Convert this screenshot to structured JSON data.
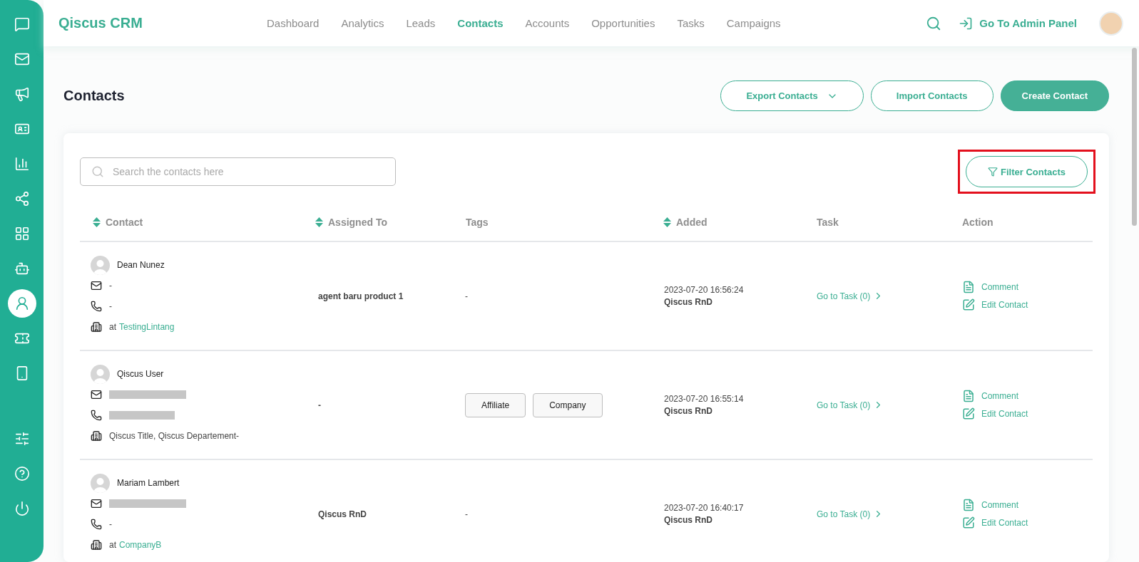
{
  "sidebar": {
    "items": [
      {
        "kind": "chat",
        "selected": false
      },
      {
        "kind": "mail",
        "selected": false
      },
      {
        "kind": "megaphone",
        "selected": false
      },
      {
        "kind": "card",
        "selected": false
      },
      {
        "kind": "chart",
        "selected": false
      },
      {
        "kind": "share",
        "selected": false
      },
      {
        "kind": "grid",
        "selected": false
      },
      {
        "kind": "bot",
        "selected": false
      },
      {
        "kind": "agent",
        "selected": true
      },
      {
        "kind": "ticket",
        "selected": false
      },
      {
        "kind": "phone",
        "selected": false
      }
    ],
    "bottom_items": [
      {
        "kind": "sliders"
      },
      {
        "kind": "help"
      },
      {
        "kind": "power"
      }
    ]
  },
  "header": {
    "brand": "Qiscus CRM",
    "nav": [
      {
        "label": "Dashboard",
        "selected": false
      },
      {
        "label": "Analytics",
        "selected": false
      },
      {
        "label": "Leads",
        "selected": false
      },
      {
        "label": "Contacts",
        "selected": true
      },
      {
        "label": "Accounts",
        "selected": false
      },
      {
        "label": "Opportunities",
        "selected": false
      },
      {
        "label": "Tasks",
        "selected": false
      },
      {
        "label": "Campaigns",
        "selected": false
      }
    ],
    "admin_link": "Go To Admin Panel"
  },
  "page": {
    "title": "Contacts",
    "buttons": [
      {
        "label": "Export Contacts",
        "kind": "dropdown"
      },
      {
        "label": "Import Contacts",
        "kind": "outline"
      },
      {
        "label": "Create Contact",
        "kind": "primary"
      }
    ]
  },
  "search": {
    "placeholder": "Search the contacts here"
  },
  "filter_button": {
    "label": "Filter Contacts",
    "highlighted": true
  },
  "table": {
    "columns": [
      {
        "label": "Contact",
        "sortable": true
      },
      {
        "label": "Assigned To",
        "sortable": true
      },
      {
        "label": "Tags",
        "sortable": false
      },
      {
        "label": "Added",
        "sortable": true
      },
      {
        "label": "Task",
        "sortable": false
      },
      {
        "label": "Action",
        "sortable": false
      }
    ],
    "rows": [
      {
        "name": "Dean Nunez",
        "email": {
          "kind": "text",
          "value": "-"
        },
        "phone": {
          "kind": "text",
          "value": "-"
        },
        "org": {
          "kind": "company",
          "prefix": "at",
          "value": "TestingLintang"
        },
        "assigned": "agent baru product 1",
        "tags": [],
        "tags_empty": "-",
        "added": "2023-07-20 16:56:24",
        "added_by": "Qiscus RnD",
        "task": "Go to Task (0)",
        "actions": [
          "Comment",
          "Edit Contact"
        ]
      },
      {
        "name": "Qiscus User",
        "email": {
          "kind": "redacted"
        },
        "phone": {
          "kind": "redacted"
        },
        "org": {
          "kind": "title",
          "value": "Qiscus Title, Qiscus Departement-"
        },
        "assigned": "-",
        "tags": [
          "Affiliate",
          "Company"
        ],
        "added": "2023-07-20 16:55:14",
        "added_by": "Qiscus RnD",
        "task": "Go to Task (0)",
        "actions": [
          "Comment",
          "Edit Contact"
        ]
      },
      {
        "name": "Mariam Lambert",
        "email": {
          "kind": "redacted"
        },
        "phone": {
          "kind": "text",
          "value": "-"
        },
        "org": {
          "kind": "company",
          "prefix": "at",
          "value": "CompanyB"
        },
        "assigned": "Qiscus RnD",
        "tags": [],
        "tags_empty": "-",
        "added": "2023-07-20 16:40:17",
        "added_by": "Qiscus RnD",
        "task": "Go to Task (0)",
        "actions": [
          "Comment",
          "Edit Contact"
        ]
      }
    ]
  }
}
